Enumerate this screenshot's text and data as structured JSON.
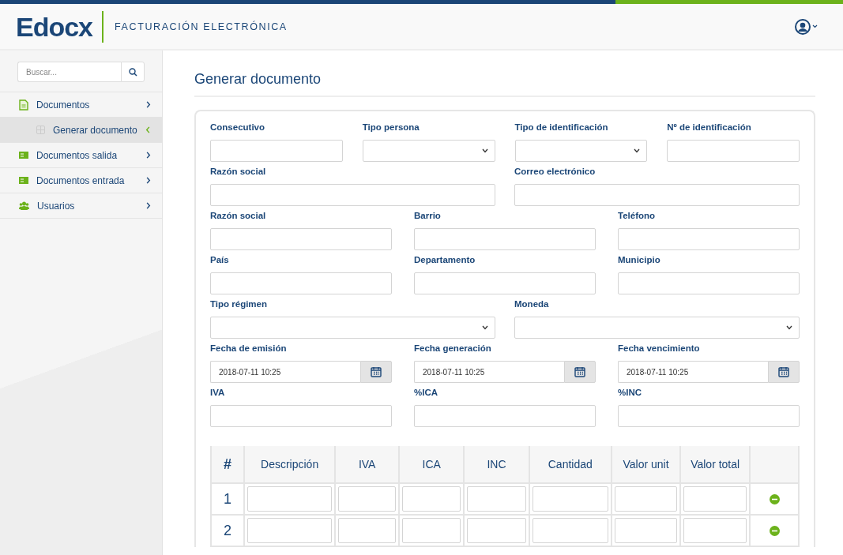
{
  "header": {
    "logo": "Edocx",
    "subtitle": "FACTURACIÓN ELECTRÓNICA"
  },
  "sidebar": {
    "search": {
      "placeholder": "Buscar..."
    },
    "items": [
      {
        "label": "Documentos",
        "kind": "document",
        "selected": false,
        "children": [
          {
            "label": "Generar documento",
            "selected": true
          }
        ]
      },
      {
        "label": "Documentos salida",
        "kind": "card",
        "selected": false
      },
      {
        "label": "Documentos entrada",
        "kind": "card",
        "selected": false
      },
      {
        "label": "Usuarios",
        "kind": "users",
        "selected": false
      }
    ]
  },
  "page_title": "Generar documento",
  "form": {
    "rows": [
      {
        "fields": [
          {
            "label": "Consecutivo",
            "kind": "text"
          },
          {
            "label": "Tipo persona",
            "kind": "select"
          },
          {
            "label": "Tipo de identificación",
            "kind": "select"
          },
          {
            "label": "Nº de identificación",
            "kind": "text"
          }
        ]
      },
      {
        "fields": [
          {
            "label": "Razón social",
            "kind": "text"
          },
          {
            "label": "Correo electrónico",
            "kind": "text"
          }
        ]
      },
      {
        "fields": [
          {
            "label": "Razón social",
            "kind": "text"
          },
          {
            "label": "Barrio",
            "kind": "text"
          },
          {
            "label": "Teléfono",
            "kind": "text"
          }
        ]
      },
      {
        "fields": [
          {
            "label": "País",
            "kind": "text"
          },
          {
            "label": "Departamento",
            "kind": "text"
          },
          {
            "label": "Municipio",
            "kind": "text"
          }
        ]
      },
      {
        "fields": [
          {
            "label": "Tipo régimen",
            "kind": "select"
          },
          {
            "label": "Moneda",
            "kind": "select"
          }
        ]
      },
      {
        "fields": [
          {
            "label": "Fecha de emisión",
            "kind": "date",
            "value": "2018-07-11 10:25"
          },
          {
            "label": "Fecha generación",
            "kind": "date",
            "value": "2018-07-11 10:25"
          },
          {
            "label": "Fecha vencimiento",
            "kind": "date",
            "value": "2018-07-11 10:25"
          }
        ]
      },
      {
        "fields": [
          {
            "label": "IVA",
            "kind": "text"
          },
          {
            "label": "%ICA",
            "kind": "text"
          },
          {
            "label": "%INC",
            "kind": "text"
          }
        ]
      }
    ]
  },
  "table": {
    "columns": [
      "#",
      "Descripción",
      "IVA",
      "ICA",
      "INC",
      "Cantidad",
      "Valor unit",
      "Valor total"
    ],
    "rows": [
      {
        "number": "1"
      },
      {
        "number": "2"
      }
    ]
  }
}
